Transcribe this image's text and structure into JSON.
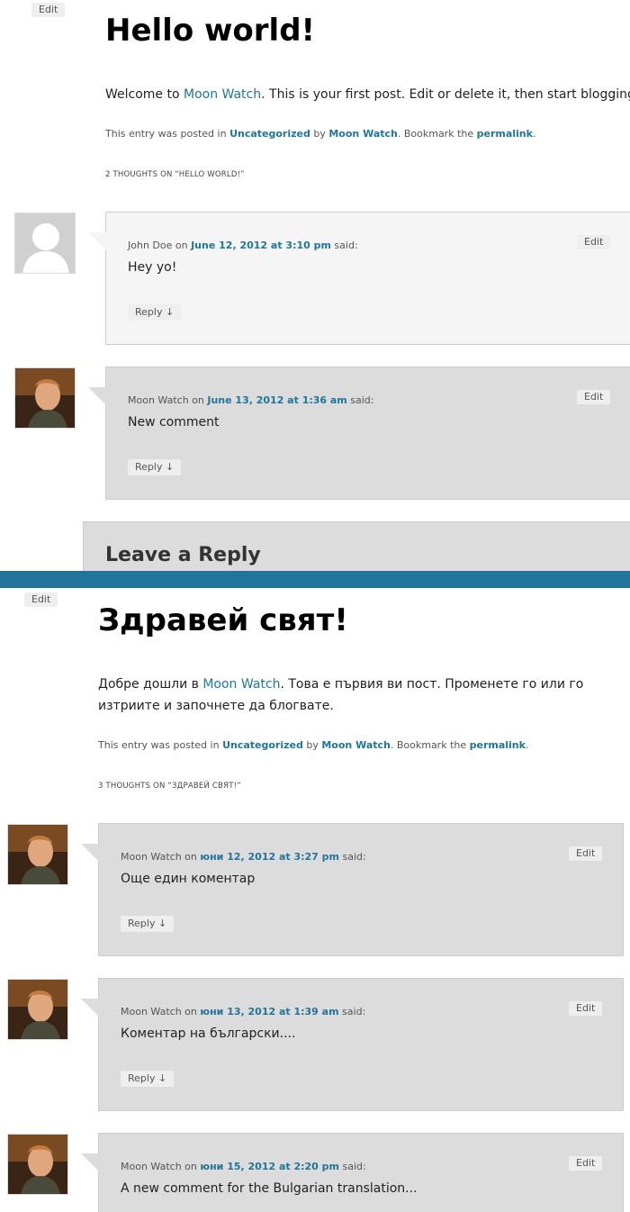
{
  "post1": {
    "edit": "Edit",
    "title": "Hello world!",
    "content_pre": "Welcome to ",
    "content_link": "Moon Watch",
    "content_post": ". This is your first post. Edit or delete it, then start blogging!",
    "meta_pre": "This entry was posted in ",
    "meta_cat": "Uncategorized",
    "meta_by": " by ",
    "meta_author": "Moon Watch",
    "meta_bookmark": ". Bookmark the ",
    "meta_perma": "permalink",
    "meta_end": ".",
    "thoughts": "2 THOUGHTS ON “HELLO WORLD!”",
    "comments": [
      {
        "author": "John Doe",
        "on": " on ",
        "date": "June 12, 2012 at 3:10 pm",
        "said": " said:",
        "text": "Hey yo!",
        "reply": "Reply ↓",
        "edit": "Edit"
      },
      {
        "author": "Moon Watch",
        "on": " on ",
        "date": "June 13, 2012 at 1:36 am",
        "said": " said:",
        "text": "New comment",
        "reply": "Reply ↓",
        "edit": "Edit"
      }
    ],
    "leave_reply": "Leave a Reply"
  },
  "post2": {
    "edit": "Edit",
    "title": "Здравей свят!",
    "content_pre": "Добре дошли в ",
    "content_link": "Moon Watch",
    "content_post1": ". Това е първия ви пост. Променете го или го",
    "content_post2": "изтриите и започнете да блогвате.",
    "meta_pre": "This entry was posted in ",
    "meta_cat": "Uncategorized",
    "meta_by": " by ",
    "meta_author": "Moon Watch",
    "meta_bookmark": ". Bookmark the ",
    "meta_perma": "permalink",
    "meta_end": ".",
    "thoughts": "3 THOUGHTS ON “ЗДРАВЕЙ СВЯТ!”",
    "comments": [
      {
        "author": "Moon Watch",
        "on": " on ",
        "date": "юни 12, 2012 at 3:27 pm",
        "said": " said:",
        "text": "Още един коментар",
        "reply": "Reply ↓",
        "edit": "Edit"
      },
      {
        "author": "Moon Watch",
        "on": " on ",
        "date": "юни 13, 2012 at 1:39 am",
        "said": " said:",
        "text": "Коментар на български....",
        "reply": "Reply ↓",
        "edit": "Edit"
      },
      {
        "author": "Moon Watch",
        "on": " on ",
        "date": "юни 15, 2012 at 2:20 pm",
        "said": " said:",
        "text": "A new comment for the Bulgarian translation...",
        "edit": "Edit"
      }
    ]
  },
  "colors": {
    "link": "#21759b",
    "divider": "#21759b",
    "comment_light": "#f5f5f5",
    "comment_dark": "#dcdcdc"
  }
}
